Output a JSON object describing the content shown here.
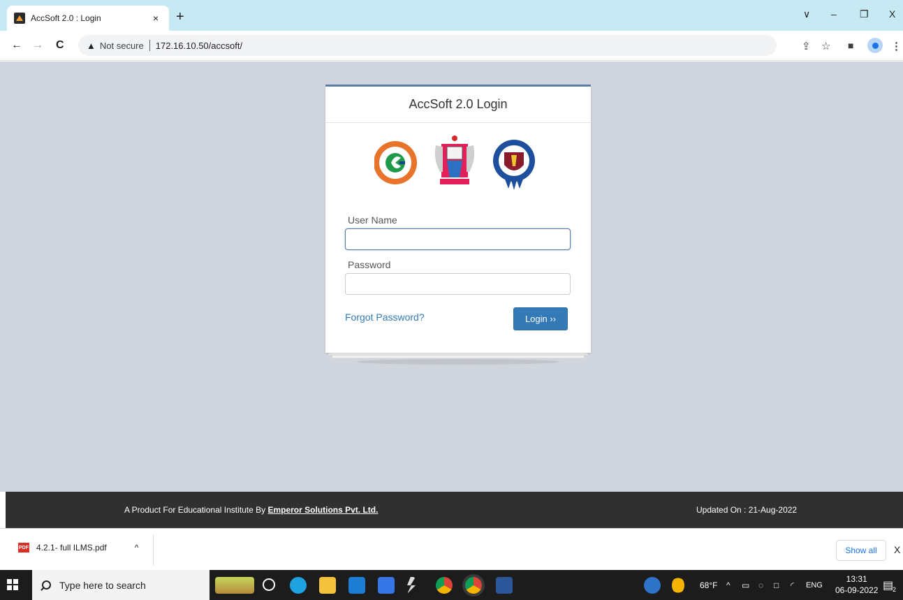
{
  "browser": {
    "tab_title": "AccSoft 2.0 : Login",
    "tab_close": "×",
    "new_tab": "+",
    "window_controls": {
      "dropdown": "∨",
      "minimize": "–",
      "restore": "❐",
      "close": "X"
    },
    "nav": {
      "back": "←",
      "forward": "→",
      "reload": "C"
    },
    "security_label": "Not secure",
    "url": "172.16.10.50/accsoft/",
    "icons": [
      "share-icon",
      "star-icon",
      "side-panel-icon",
      "profile-icon",
      "menu-icon"
    ]
  },
  "login": {
    "title": "AccSoft 2.0 Login",
    "username_label": "User Name",
    "username_value": "",
    "password_label": "Password",
    "password_value": "",
    "forgot_password": "Forgot Password?",
    "login_button": "Login ››"
  },
  "footer": {
    "product_text": "A Product For Educational Institute By ",
    "company_link": "Emperor Solutions Pvt. Ltd.",
    "updated": "Updated On : 21-Aug-2022"
  },
  "downloads": {
    "file_name": "4.2.1- full ILMS.pdf",
    "file_badge": "PDF",
    "chevron": "^",
    "show_all": "Show all",
    "close": "X"
  },
  "taskbar": {
    "search_placeholder": "Type here to search",
    "weather": "68°F",
    "language": "ENG",
    "time": "13:31",
    "date": "06-09-2022",
    "notification_count": "2"
  },
  "colors": {
    "page_background": "#d1d5dd",
    "card_accent": "#5c7ca3",
    "login_button": "#337ab7",
    "footer": "#303030",
    "tabstrip": "#c6e9f4"
  }
}
